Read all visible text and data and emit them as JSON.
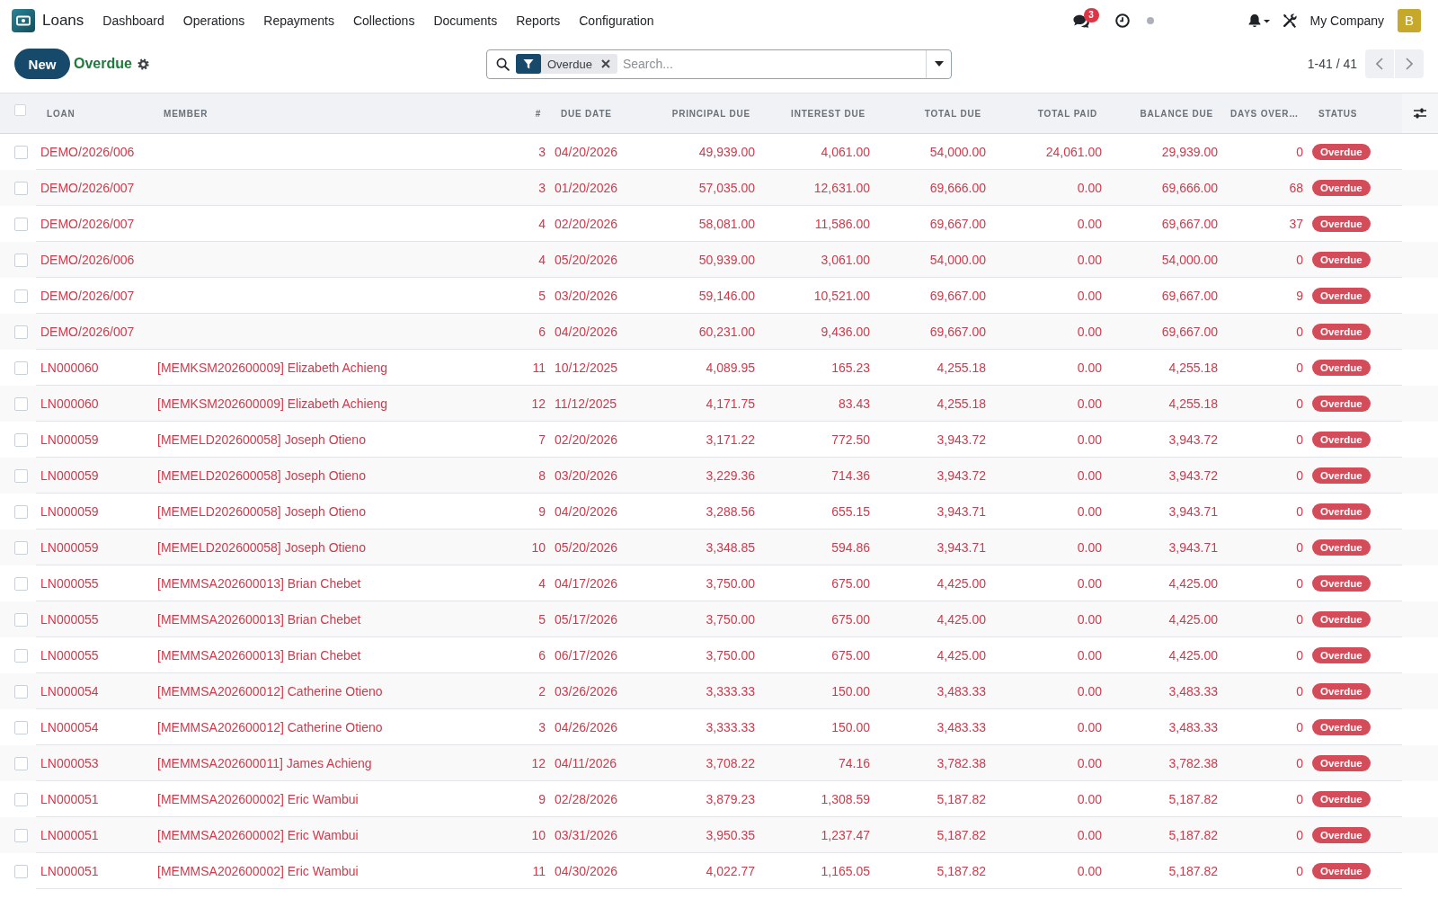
{
  "navbar": {
    "app_name": "Loans",
    "menu": [
      "Dashboard",
      "Operations",
      "Repayments",
      "Collections",
      "Documents",
      "Reports",
      "Configuration"
    ],
    "messages_count": "3",
    "company": "My Company",
    "avatar_initial": "B"
  },
  "control_panel": {
    "new_button": "New",
    "view_title": "Overdue",
    "search": {
      "facets": [
        {
          "label": "Overdue"
        }
      ],
      "placeholder": "Search..."
    },
    "pager": "1-41 / 41"
  },
  "table": {
    "all_selected": false,
    "columns": [
      {
        "label": "LOAN",
        "kind": "text"
      },
      {
        "label": "MEMBER",
        "kind": "text"
      },
      {
        "label": "#",
        "kind": "number"
      },
      {
        "label": "DUE DATE",
        "kind": "text"
      },
      {
        "label": "PRINCIPAL DUE",
        "kind": "number"
      },
      {
        "label": "INTEREST DUE",
        "kind": "number"
      },
      {
        "label": "TOTAL DUE",
        "kind": "number"
      },
      {
        "label": "TOTAL PAID",
        "kind": "number"
      },
      {
        "label": "BALANCE DUE",
        "kind": "number"
      },
      {
        "label": "DAYS OVER…",
        "kind": "number"
      },
      {
        "label": "STATUS",
        "kind": "badge"
      }
    ],
    "rows": [
      {
        "selected": false,
        "overdue": true,
        "loan": "DEMO/2026/006",
        "installment": "3",
        "due_date": "04/20/2026",
        "principal_due": "49,939.00",
        "interest_due": "4,061.00",
        "total_due": "54,000.00",
        "total_paid": "24,061.00",
        "balance_due": "29,939.00",
        "days_overdue": "0",
        "status": "Overdue"
      },
      {
        "selected": false,
        "overdue": true,
        "loan": "DEMO/2026/007",
        "installment": "3",
        "due_date": "01/20/2026",
        "principal_due": "57,035.00",
        "interest_due": "12,631.00",
        "total_due": "69,666.00",
        "total_paid": "0.00",
        "balance_due": "69,666.00",
        "days_overdue": "68",
        "status": "Overdue"
      },
      {
        "selected": false,
        "overdue": true,
        "loan": "DEMO/2026/007",
        "installment": "4",
        "due_date": "02/20/2026",
        "principal_due": "58,081.00",
        "interest_due": "11,586.00",
        "total_due": "69,667.00",
        "total_paid": "0.00",
        "balance_due": "69,667.00",
        "days_overdue": "37",
        "status": "Overdue"
      },
      {
        "selected": false,
        "overdue": true,
        "loan": "DEMO/2026/006",
        "installment": "4",
        "due_date": "05/20/2026",
        "principal_due": "50,939.00",
        "interest_due": "3,061.00",
        "total_due": "54,000.00",
        "total_paid": "0.00",
        "balance_due": "54,000.00",
        "days_overdue": "0",
        "status": "Overdue"
      },
      {
        "selected": false,
        "overdue": true,
        "loan": "DEMO/2026/007",
        "installment": "5",
        "due_date": "03/20/2026",
        "principal_due": "59,146.00",
        "interest_due": "10,521.00",
        "total_due": "69,667.00",
        "total_paid": "0.00",
        "balance_due": "69,667.00",
        "days_overdue": "9",
        "status": "Overdue"
      },
      {
        "selected": false,
        "overdue": true,
        "loan": "DEMO/2026/007",
        "installment": "6",
        "due_date": "04/20/2026",
        "principal_due": "60,231.00",
        "interest_due": "9,436.00",
        "total_due": "69,667.00",
        "total_paid": "0.00",
        "balance_due": "69,667.00",
        "days_overdue": "0",
        "status": "Overdue"
      },
      {
        "selected": false,
        "overdue": true,
        "loan": "LN000060",
        "member": "[MEMKSM202600009] Elizabeth Achieng",
        "installment": "11",
        "due_date": "10/12/2025",
        "principal_due": "4,089.95",
        "interest_due": "165.23",
        "total_due": "4,255.18",
        "total_paid": "0.00",
        "balance_due": "4,255.18",
        "days_overdue": "0",
        "status": "Overdue"
      },
      {
        "selected": false,
        "overdue": true,
        "loan": "LN000060",
        "member": "[MEMKSM202600009] Elizabeth Achieng",
        "installment": "12",
        "due_date": "11/12/2025",
        "principal_due": "4,171.75",
        "interest_due": "83.43",
        "total_due": "4,255.18",
        "total_paid": "0.00",
        "balance_due": "4,255.18",
        "days_overdue": "0",
        "status": "Overdue"
      },
      {
        "selected": false,
        "overdue": true,
        "loan": "LN000059",
        "member": "[MEMELD202600058] Joseph Otieno",
        "installment": "7",
        "due_date": "02/20/2026",
        "principal_due": "3,171.22",
        "interest_due": "772.50",
        "total_due": "3,943.72",
        "total_paid": "0.00",
        "balance_due": "3,943.72",
        "days_overdue": "0",
        "status": "Overdue"
      },
      {
        "selected": false,
        "overdue": true,
        "loan": "LN000059",
        "member": "[MEMELD202600058] Joseph Otieno",
        "installment": "8",
        "due_date": "03/20/2026",
        "principal_due": "3,229.36",
        "interest_due": "714.36",
        "total_due": "3,943.72",
        "total_paid": "0.00",
        "balance_due": "3,943.72",
        "days_overdue": "0",
        "status": "Overdue"
      },
      {
        "selected": false,
        "overdue": true,
        "loan": "LN000059",
        "member": "[MEMELD202600058] Joseph Otieno",
        "installment": "9",
        "due_date": "04/20/2026",
        "principal_due": "3,288.56",
        "interest_due": "655.15",
        "total_due": "3,943.71",
        "total_paid": "0.00",
        "balance_due": "3,943.71",
        "days_overdue": "0",
        "status": "Overdue"
      },
      {
        "selected": false,
        "overdue": true,
        "loan": "LN000059",
        "member": "[MEMELD202600058] Joseph Otieno",
        "installment": "10",
        "due_date": "05/20/2026",
        "principal_due": "3,348.85",
        "interest_due": "594.86",
        "total_due": "3,943.71",
        "total_paid": "0.00",
        "balance_due": "3,943.71",
        "days_overdue": "0",
        "status": "Overdue"
      },
      {
        "selected": false,
        "overdue": true,
        "loan": "LN000055",
        "member": "[MEMMSA202600013] Brian Chebet",
        "installment": "4",
        "due_date": "04/17/2026",
        "principal_due": "3,750.00",
        "interest_due": "675.00",
        "total_due": "4,425.00",
        "total_paid": "0.00",
        "balance_due": "4,425.00",
        "days_overdue": "0",
        "status": "Overdue"
      },
      {
        "selected": false,
        "overdue": true,
        "loan": "LN000055",
        "member": "[MEMMSA202600013] Brian Chebet",
        "installment": "5",
        "due_date": "05/17/2026",
        "principal_due": "3,750.00",
        "interest_due": "675.00",
        "total_due": "4,425.00",
        "total_paid": "0.00",
        "balance_due": "4,425.00",
        "days_overdue": "0",
        "status": "Overdue"
      },
      {
        "selected": false,
        "overdue": true,
        "loan": "LN000055",
        "member": "[MEMMSA202600013] Brian Chebet",
        "installment": "6",
        "due_date": "06/17/2026",
        "principal_due": "3,750.00",
        "interest_due": "675.00",
        "total_due": "4,425.00",
        "total_paid": "0.00",
        "balance_due": "4,425.00",
        "days_overdue": "0",
        "status": "Overdue"
      },
      {
        "selected": false,
        "overdue": true,
        "loan": "LN000054",
        "member": "[MEMMSA202600012] Catherine Otieno",
        "installment": "2",
        "due_date": "03/26/2026",
        "principal_due": "3,333.33",
        "interest_due": "150.00",
        "total_due": "3,483.33",
        "total_paid": "0.00",
        "balance_due": "3,483.33",
        "days_overdue": "0",
        "status": "Overdue"
      },
      {
        "selected": false,
        "overdue": true,
        "loan": "LN000054",
        "member": "[MEMMSA202600012] Catherine Otieno",
        "installment": "3",
        "due_date": "04/26/2026",
        "principal_due": "3,333.33",
        "interest_due": "150.00",
        "total_due": "3,483.33",
        "total_paid": "0.00",
        "balance_due": "3,483.33",
        "days_overdue": "0",
        "status": "Overdue"
      },
      {
        "selected": false,
        "overdue": true,
        "loan": "LN000053",
        "member": "[MEMMSA202600011] James Achieng",
        "installment": "12",
        "due_date": "04/11/2026",
        "principal_due": "3,708.22",
        "interest_due": "74.16",
        "total_due": "3,782.38",
        "total_paid": "0.00",
        "balance_due": "3,782.38",
        "days_overdue": "0",
        "status": "Overdue"
      },
      {
        "selected": false,
        "overdue": true,
        "loan": "LN000051",
        "member": "[MEMMSA202600002] Eric Wambui",
        "installment": "9",
        "due_date": "02/28/2026",
        "principal_due": "3,879.23",
        "interest_due": "1,308.59",
        "total_due": "5,187.82",
        "total_paid": "0.00",
        "balance_due": "5,187.82",
        "days_overdue": "0",
        "status": "Overdue"
      },
      {
        "selected": false,
        "overdue": true,
        "loan": "LN000051",
        "member": "[MEMMSA202600002] Eric Wambui",
        "installment": "10",
        "due_date": "03/31/2026",
        "principal_due": "3,950.35",
        "interest_due": "1,237.47",
        "total_due": "5,187.82",
        "total_paid": "0.00",
        "balance_due": "5,187.82",
        "days_overdue": "0",
        "status": "Overdue"
      },
      {
        "selected": false,
        "overdue": true,
        "loan": "LN000051",
        "member": "[MEMMSA202600002] Eric Wambui",
        "installment": "11",
        "due_date": "04/30/2026",
        "principal_due": "4,022.77",
        "interest_due": "1,165.05",
        "total_due": "5,187.82",
        "total_paid": "0.00",
        "balance_due": "5,187.82",
        "days_overdue": "0",
        "status": "Overdue"
      }
    ]
  }
}
